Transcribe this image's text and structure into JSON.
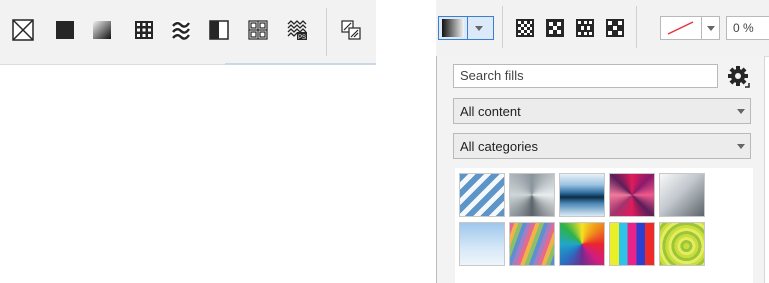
{
  "fill_toolbar": {
    "buttons": [
      {
        "icon": "no-fill-icon"
      },
      {
        "icon": "uniform-fill-icon"
      },
      {
        "icon": "fountain-fill-icon"
      },
      {
        "icon": "vector-pattern-fill-icon"
      },
      {
        "icon": "bitmap-pattern-fill-icon"
      },
      {
        "icon": "two-color-pattern-fill-icon"
      },
      {
        "icon": "texture-fill-icon"
      },
      {
        "icon": "postscript-fill-icon"
      },
      {
        "icon": "copy-fill-properties-icon"
      }
    ]
  },
  "picker_toolbar": {
    "zoom_text": "0 %"
  },
  "fill_picker": {
    "search": {
      "placeholder": "Search fills",
      "value": ""
    },
    "content_select": {
      "selected": "All content"
    },
    "category_select": {
      "selected": "All categories"
    },
    "swatches": [
      {
        "name": "diagonal-stripes"
      },
      {
        "name": "silver-conical"
      },
      {
        "name": "blue-metal-bands"
      },
      {
        "name": "magenta-starburst"
      },
      {
        "name": "silver-gradient"
      },
      {
        "name": "sky-blue-gradient"
      },
      {
        "name": "rainbow-diagonal-stripes"
      },
      {
        "name": "color-pinwheel"
      },
      {
        "name": "vertical-rainbow-bars"
      },
      {
        "name": "green-concentric-rings"
      }
    ]
  },
  "colors": {
    "toolbar_bg": "#f2f2f2",
    "panel_bg": "#f3f3f3",
    "icon_dark": "#262626",
    "selected_border": "#3b7fd0"
  }
}
